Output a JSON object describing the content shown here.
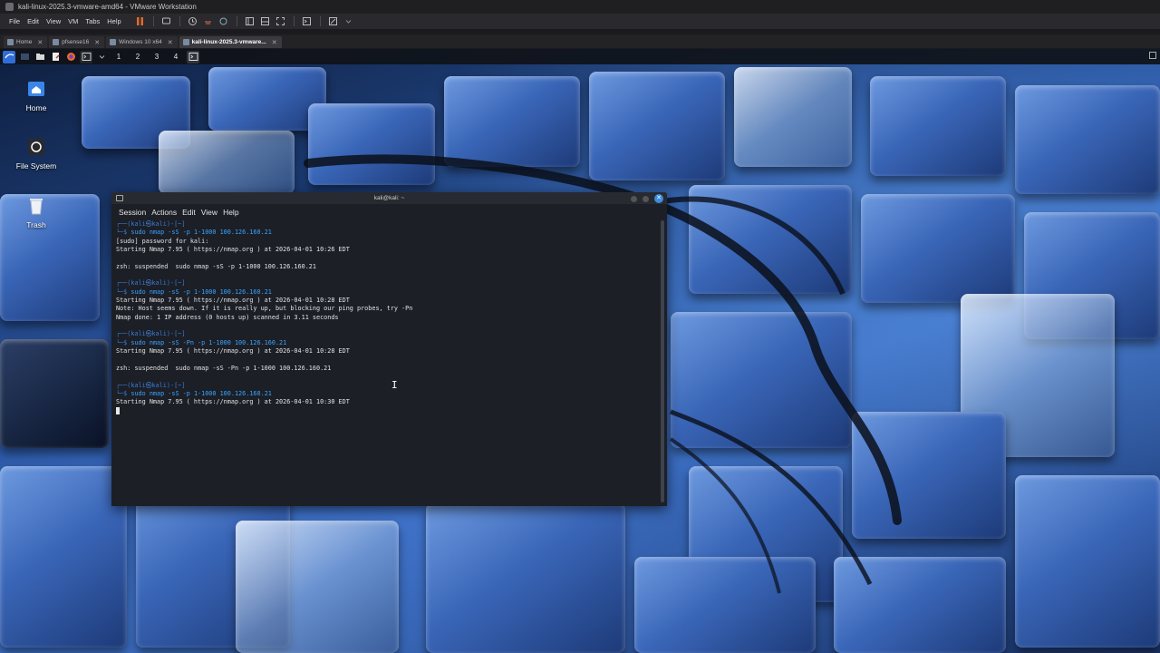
{
  "host": {
    "window_title": "kali-linux-2025.3-vmware-amd64 - VMware Workstation",
    "menu": [
      "File",
      "Edit",
      "View",
      "VM",
      "Tabs",
      "Help"
    ],
    "tabs": [
      {
        "label": "Home",
        "active": false
      },
      {
        "label": "pfsense16",
        "active": false
      },
      {
        "label": "Windows 10 x64",
        "active": false
      },
      {
        "label": "kali-linux-2025.3-vmware...",
        "active": true
      }
    ]
  },
  "guest": {
    "panel": {
      "workspaces": [
        "1",
        "2",
        "3",
        "4"
      ]
    },
    "desktop_icons": [
      {
        "label": "Home",
        "icon": "home-icon"
      },
      {
        "label": "File System",
        "icon": "drive-icon"
      },
      {
        "label": "Trash",
        "icon": "trash-icon"
      }
    ],
    "terminal": {
      "title": "kali@kali: ~",
      "menu": [
        "Session",
        "Actions",
        "Edit",
        "View",
        "Help"
      ],
      "prompt_top": "┌──(kali㉿kali)-[~]",
      "prompt_arrow": "└─$ ",
      "lines": [
        {
          "type": "prompt"
        },
        {
          "type": "cmd",
          "text": "sudo nmap -sS -p 1-1000 100.126.160.21"
        },
        {
          "type": "out",
          "text": "[sudo] password for kali:"
        },
        {
          "type": "out",
          "text": "Starting Nmap 7.95 ( https://nmap.org ) at 2026-04-01 10:26 EDT"
        },
        {
          "type": "out",
          "text": ""
        },
        {
          "type": "out",
          "text": "zsh: suspended  sudo nmap -sS -p 1-1000 100.126.160.21"
        },
        {
          "type": "out",
          "text": ""
        },
        {
          "type": "prompt"
        },
        {
          "type": "cmd",
          "text": "sudo nmap -sS -p 1-1000 100.126.160.21"
        },
        {
          "type": "out",
          "text": "Starting Nmap 7.95 ( https://nmap.org ) at 2026-04-01 10:28 EDT"
        },
        {
          "type": "out",
          "text": "Note: Host seems down. If it is really up, but blocking our ping probes, try -Pn"
        },
        {
          "type": "out",
          "text": "Nmap done: 1 IP address (0 hosts up) scanned in 3.11 seconds"
        },
        {
          "type": "out",
          "text": ""
        },
        {
          "type": "prompt"
        },
        {
          "type": "cmd",
          "text": "sudo nmap -sS -Pn -p 1-1000 100.126.160.21"
        },
        {
          "type": "out",
          "text": "Starting Nmap 7.95 ( https://nmap.org ) at 2026-04-01 10:28 EDT"
        },
        {
          "type": "out",
          "text": ""
        },
        {
          "type": "out",
          "text": "zsh: suspended  sudo nmap -sS -Pn -p 1-1000 100.126.160.21"
        },
        {
          "type": "out",
          "text": ""
        },
        {
          "type": "prompt"
        },
        {
          "type": "cmd",
          "text": "sudo nmap -sS -p 1-1000 100.126.160.21"
        },
        {
          "type": "out",
          "text": "Starting Nmap 7.95 ( https://nmap.org ) at 2026-04-01 10:30 EDT"
        },
        {
          "type": "cursor"
        }
      ]
    }
  }
}
